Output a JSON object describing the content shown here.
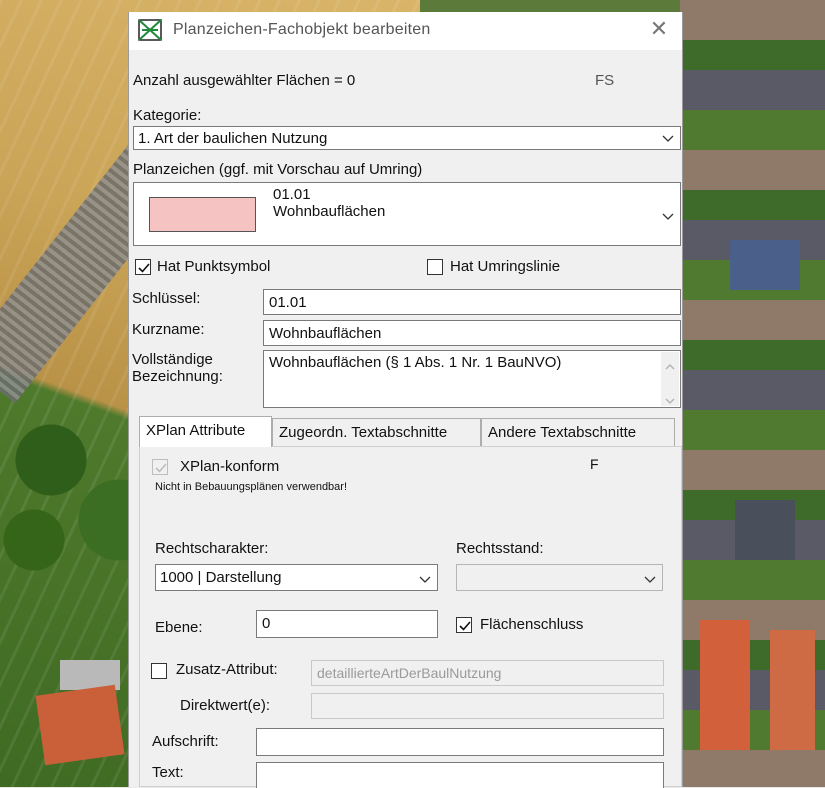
{
  "window": {
    "title": "Planzeichen-Fachobjekt bearbeiten",
    "close_glyph": "✕"
  },
  "selection": {
    "count_text": "Anzahl ausgewählter Flächen = 0",
    "code": "FS"
  },
  "kategorie": {
    "label": "Kategorie:",
    "value": "1. Art der baulichen Nutzung"
  },
  "planzeichen": {
    "label": "Planzeichen (ggf. mit Vorschau auf Umring)",
    "code": "01.01",
    "name": "Wohnbauflächen",
    "swatch_color": "#f6c3c3"
  },
  "options": {
    "punktsymbol_label": "Hat Punktsymbol",
    "punktsymbol_checked": true,
    "umringslinie_label": "Hat Umringslinie",
    "umringslinie_checked": false
  },
  "fields": {
    "schluessel_label": "Schlüssel:",
    "schluessel_value": "01.01",
    "kurzname_label": "Kurzname:",
    "kurzname_value": "Wohnbauflächen",
    "vollst_label_1": "Vollständige",
    "vollst_label_2": "Bezeichnung:",
    "vollst_value": "Wohnbauflächen (§ 1 Abs. 1 Nr. 1 BauNVO)"
  },
  "tabs": [
    {
      "label": "XPlan Attribute",
      "active": true
    },
    {
      "label": "Zugeordn. Textabschnitte",
      "active": false
    },
    {
      "label": "Andere Textabschnitte",
      "active": false
    }
  ],
  "xplan": {
    "konform_label": "XPlan-konform",
    "konform_flag": "F",
    "hint": "Nicht in Bebauungsplänen verwendbar!",
    "rechtscharakter_label": "Rechtscharakter:",
    "rechtscharakter_value": "1000 | Darstellung",
    "rechtsstand_label": "Rechtsstand:",
    "rechtsstand_value": "",
    "ebene_label": "Ebene:",
    "ebene_value": "0",
    "flaechenschluss_label": "Flächenschluss",
    "flaechenschluss_checked": true,
    "zusatz_label": "Zusatz-Attribut:",
    "zusatz_value": "detaillierteArtDerBaulNutzung",
    "direktwert_label": "Direktwert(e):",
    "direktwert_value": "",
    "aufschrift_label": "Aufschrift:",
    "aufschrift_value": "",
    "text_label": "Text:",
    "text_value": ""
  },
  "icons": {
    "app": "planzeichen-icon",
    "dropdown": "chevron-down-icon",
    "check": "checkmark-icon"
  }
}
